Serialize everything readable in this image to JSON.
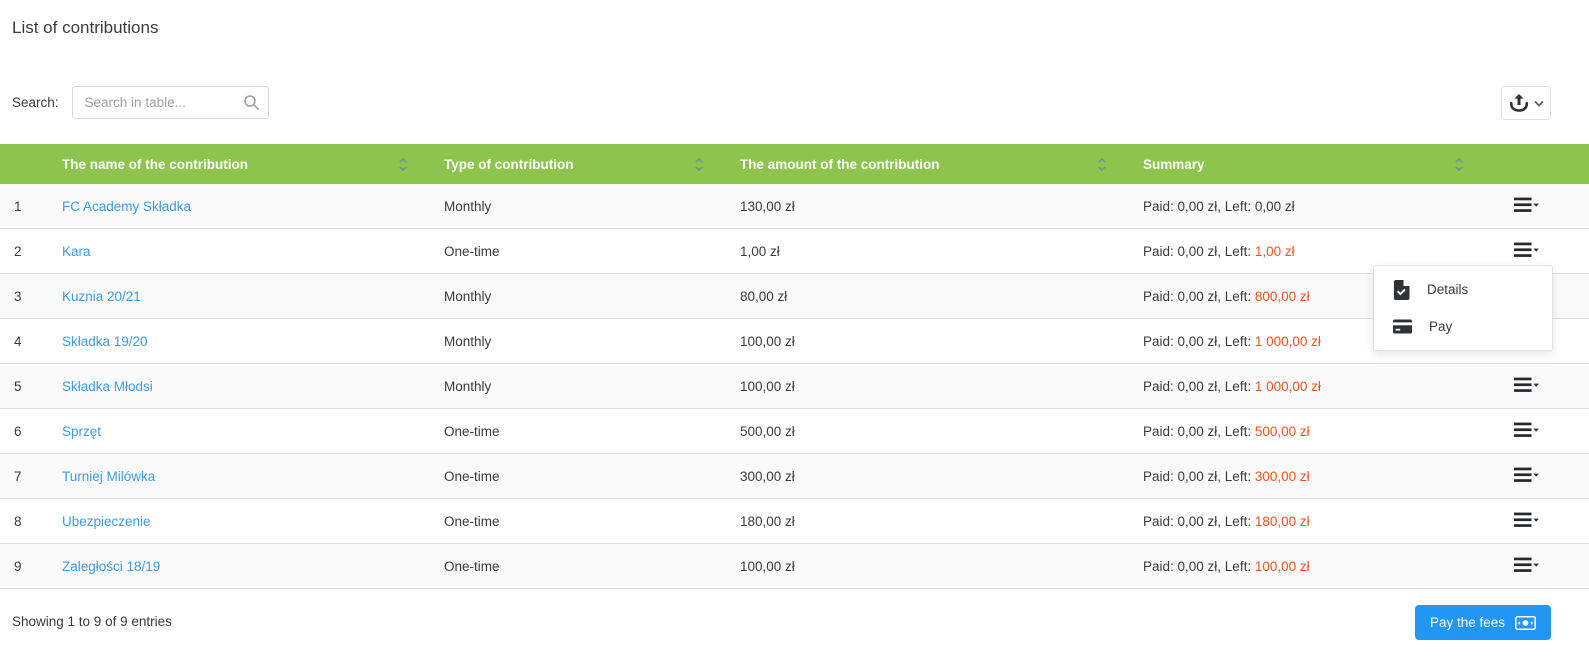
{
  "page": {
    "title": "List of contributions"
  },
  "search": {
    "label": "Search:",
    "placeholder": "Search in table..."
  },
  "toolbar": {
    "export_icon": "export-icon",
    "export_chevron_icon": "chevron-down-icon"
  },
  "table": {
    "columns": [
      "The name of the contribution",
      "Type of contribution",
      "The amount of the contribution",
      "Summary"
    ],
    "rows": [
      {
        "no": "1",
        "name": "FC Academy Składka",
        "type": "Monthly",
        "amount": "130,00 zł",
        "summary_prefix": "Paid: 0,00 zł, Left:",
        "summary_left": "0,00 zł",
        "overdue": false
      },
      {
        "no": "2",
        "name": "Kara",
        "type": "One-time",
        "amount": "1,00 zł",
        "summary_prefix": "Paid: 0,00 zł, Left:",
        "summary_left": "1,00 zł",
        "overdue": true
      },
      {
        "no": "3",
        "name": "Kuznia 20/21",
        "type": "Monthly",
        "amount": "80,00 zł",
        "summary_prefix": "Paid: 0,00 zł, Left:",
        "summary_left": "800,00 zł",
        "overdue": true
      },
      {
        "no": "4",
        "name": "Składka 19/20",
        "type": "Monthly",
        "amount": "100,00 zł",
        "summary_prefix": "Paid: 0,00 zł, Left:",
        "summary_left": "1 000,00 zł",
        "overdue": true
      },
      {
        "no": "5",
        "name": "Składka Młodsi",
        "type": "Monthly",
        "amount": "100,00 zł",
        "summary_prefix": "Paid: 0,00 zł, Left:",
        "summary_left": "1 000,00 zł",
        "overdue": true
      },
      {
        "no": "6",
        "name": "Sprzęt",
        "type": "One-time",
        "amount": "500,00 zł",
        "summary_prefix": "Paid: 0,00 zł, Left:",
        "summary_left": "500,00 zł",
        "overdue": true
      },
      {
        "no": "7",
        "name": "Turniej Milówka",
        "type": "One-time",
        "amount": "300,00 zł",
        "summary_prefix": "Paid: 0,00 zł, Left:",
        "summary_left": "300,00 zł",
        "overdue": true
      },
      {
        "no": "8",
        "name": "Ubezpieczenie",
        "type": "One-time",
        "amount": "180,00 zł",
        "summary_prefix": "Paid: 0,00 zł, Left:",
        "summary_left": "180,00 zł",
        "overdue": true
      },
      {
        "no": "9",
        "name": "Zaległości 18/19",
        "type": "One-time",
        "amount": "100,00 zł",
        "summary_prefix": "Paid: 0,00 zł, Left:",
        "summary_left": "100,00 zł",
        "overdue": true
      }
    ]
  },
  "menu": {
    "items": [
      {
        "label": "Details",
        "icon": "document-check-icon"
      },
      {
        "label": "Pay",
        "icon": "credit-card-icon"
      }
    ]
  },
  "footer": {
    "showing_text": "Showing 1 to 9 of 9 entries",
    "pay_button_label": "Pay the fees"
  },
  "colors": {
    "header_green": "#8cc44e",
    "link_blue": "#3d9be9",
    "overdue_red": "#f4511e",
    "button_blue": "#2196f3"
  }
}
